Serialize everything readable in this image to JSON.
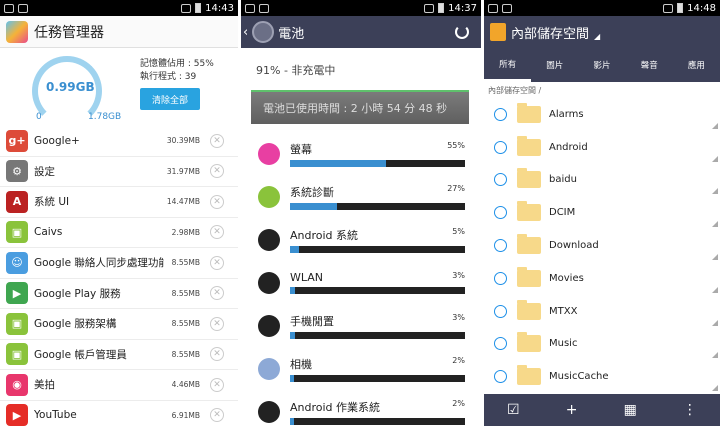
{
  "colors": {
    "accent": "#29a3e0",
    "header_dark": "#3c4058",
    "folder": "#f7d98a"
  },
  "panel1": {
    "status_time": "14:43",
    "title": "任務管理器",
    "gauge_value": "0.99GB",
    "gauge_min": "0",
    "gauge_max": "1.78GB",
    "mem_used": "記憶體佔用 : 55%",
    "processes": "執行程式 : 39",
    "clear_all": "清除全部",
    "tasks": [
      {
        "name": "Google+",
        "size": "30.39MB",
        "icon": "google-plus-icon",
        "color": "#dd4b39",
        "glyph": "g+"
      },
      {
        "name": "設定",
        "size": "31.97MB",
        "icon": "settings-icon",
        "color": "#777",
        "glyph": "⚙"
      },
      {
        "name": "系統 UI",
        "size": "14.47MB",
        "icon": "android-text-icon",
        "color": "#b22",
        "glyph": "A"
      },
      {
        "name": "Caivs",
        "size": "2.98MB",
        "icon": "android-icon",
        "color": "#8ac33b",
        "glyph": "▣"
      },
      {
        "name": "Google 聯絡人同步處理功能",
        "size": "8.55MB",
        "icon": "contacts-icon",
        "color": "#4a9de0",
        "glyph": "☺"
      },
      {
        "name": "Google Play 服務",
        "size": "8.55MB",
        "icon": "play-services-icon",
        "color": "#3fa650",
        "glyph": "▶"
      },
      {
        "name": "Google 服務架構",
        "size": "8.55MB",
        "icon": "android-icon",
        "color": "#8ac33b",
        "glyph": "▣"
      },
      {
        "name": "Google 帳戶管理員",
        "size": "8.55MB",
        "icon": "android-icon",
        "color": "#8ac33b",
        "glyph": "▣"
      },
      {
        "name": "美拍",
        "size": "4.46MB",
        "icon": "meipai-icon",
        "color": "#e8366c",
        "glyph": "◉"
      },
      {
        "name": "YouTube",
        "size": "6.91MB",
        "icon": "youtube-icon",
        "color": "#e52d27",
        "glyph": "▶"
      }
    ]
  },
  "panel2": {
    "status_time": "14:37",
    "title": "電池",
    "charge_status": "91% - 非充電中",
    "usage_time": "電池已使用時間 : 2 小時 54 分 48 秒",
    "items": [
      {
        "name": "螢幕",
        "pct": "55%",
        "value": 55,
        "icon": "screen-icon",
        "color": "#e83fa2"
      },
      {
        "name": "系統診斷",
        "pct": "27%",
        "value": 27,
        "icon": "android-icon",
        "color": "#8ac33b"
      },
      {
        "name": "Android 系統",
        "pct": "5%",
        "value": 5,
        "icon": "android-system-icon",
        "color": "#222"
      },
      {
        "name": "WLAN",
        "pct": "3%",
        "value": 3,
        "icon": "wlan-icon",
        "color": "#222"
      },
      {
        "name": "手機閒置",
        "pct": "3%",
        "value": 3,
        "icon": "power-icon",
        "color": "#222"
      },
      {
        "name": "相機",
        "pct": "2%",
        "value": 2,
        "icon": "camera-icon",
        "color": "#8da9d6"
      },
      {
        "name": "Android 作業系統",
        "pct": "2%",
        "value": 2,
        "icon": "android-os-icon",
        "color": "#222"
      }
    ]
  },
  "panel3": {
    "status_time": "14:48",
    "title": "內部儲存空間",
    "tabs": [
      "所有",
      "圖片",
      "影片",
      "聲音",
      "應用"
    ],
    "breadcrumb": "內部儲存空間 /",
    "folders": [
      "Alarms",
      "Android",
      "baidu",
      "DCIM",
      "Download",
      "Movies",
      "MTXX",
      "Music",
      "MusicCache"
    ],
    "bottom_icons": [
      "checkbox-icon",
      "add-icon",
      "grid-icon",
      "more-icon"
    ]
  }
}
